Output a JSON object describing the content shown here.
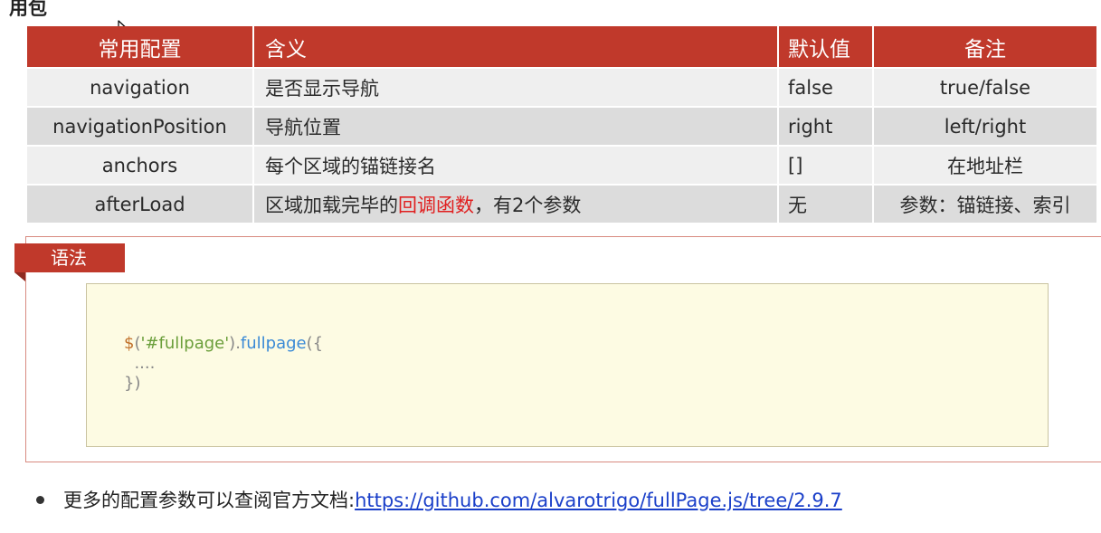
{
  "heading": "用包",
  "table": {
    "headers": [
      "常用配置",
      "含义",
      "默认值",
      "备注"
    ],
    "rows": [
      {
        "name": "navigation",
        "meaning": "是否显示导航",
        "default": "false",
        "note": "true/false"
      },
      {
        "name": "navigationPosition",
        "meaning": "导航位置",
        "default": "right",
        "note": "left/right"
      },
      {
        "name": "anchors",
        "meaning": "每个区域的锚链接名",
        "default": "[]",
        "note": "在地址栏"
      },
      {
        "name": "afterLoad",
        "meaning_before": "区域加载完毕的",
        "meaning_highlight": "回调函数",
        "meaning_after": "，有2个参数",
        "default": "无",
        "note": "参数：锚链接、索引"
      }
    ]
  },
  "syntax": {
    "tab_label": "语法",
    "code": {
      "sym": "$",
      "open": "(",
      "selector": "'#fullpage'",
      "close_dot": ").",
      "fn": "fullpage",
      "args_open": "({",
      "line2": "  ....",
      "line3": "})"
    }
  },
  "footer": {
    "text": "更多的配置参数可以查阅官方文档:",
    "link": "https://github.com/alvarotrigo/fullPage.js/tree/2.9.7"
  },
  "colors": {
    "accent": "#c0392b",
    "highlight": "#e02020",
    "code_bg": "#fdfbe3",
    "link": "#1a3fc9"
  }
}
